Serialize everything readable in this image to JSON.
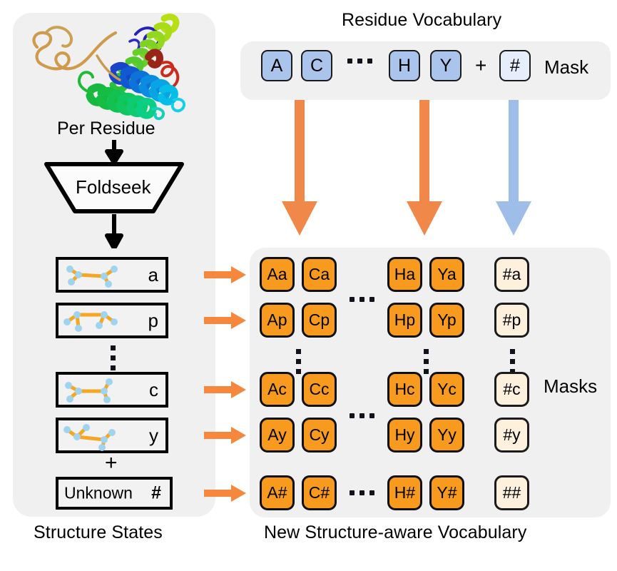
{
  "figure": {
    "title": "Structure-aware vocabulary construction diagram"
  },
  "left_panel": {
    "caption": "Structure States",
    "per_residue_label": "Per Residue",
    "foldseek_label": "Foldseek",
    "plus_sign": "+",
    "vertical_ellipsis": "⋮",
    "states": [
      {
        "letter": "a",
        "glyph": "structure-state-glyph-a"
      },
      {
        "letter": "p",
        "glyph": "structure-state-glyph-p"
      },
      {
        "letter": "c",
        "glyph": "structure-state-glyph-c"
      },
      {
        "letter": "y",
        "glyph": "structure-state-glyph-y"
      }
    ],
    "unknown": {
      "label": "Unknown",
      "symbol": "#"
    },
    "protein_icon": "protein-ribbon-structure"
  },
  "residue_vocabulary": {
    "title": "Residue Vocabulary",
    "tiles": [
      "A",
      "C",
      "H",
      "Y"
    ],
    "ellipsis": "···",
    "plus_sign": "+",
    "mask_token": "#",
    "mask_label": "Mask",
    "tile_color": "#aac4ec",
    "mask_tile_color": "#e7eefb"
  },
  "arrows": {
    "vertical": [
      {
        "name": "arrow-A-column",
        "color": "#f0884a"
      },
      {
        "name": "arrow-H-column",
        "color": "#f0884a"
      },
      {
        "name": "arrow-mask-column",
        "color": "#9ebde8"
      }
    ],
    "horizontal_color": "#f5883d",
    "black_arrow_color": "#000000"
  },
  "new_vocabulary": {
    "caption": "New Structure-aware Vocabulary",
    "masks_label": "Masks",
    "token_color": "#f79a1e",
    "mask_token_color": "#fdf0dc",
    "row_ellipsis": "···",
    "column_ellipsis": "⋮",
    "rows": [
      {
        "structure_state": "a",
        "tokens": [
          "Aa",
          "Ca",
          "Ha",
          "Ya",
          "#a"
        ]
      },
      {
        "structure_state": "p",
        "tokens": [
          "Ap",
          "Cp",
          "Hp",
          "Yp",
          "#p"
        ]
      },
      {
        "structure_state": "c",
        "tokens": [
          "Ac",
          "Cc",
          "Hc",
          "Yc",
          "#c"
        ]
      },
      {
        "structure_state": "y",
        "tokens": [
          "Ay",
          "Cy",
          "Hy",
          "Yy",
          "#y"
        ]
      },
      {
        "structure_state": "#",
        "tokens": [
          "A#",
          "C#",
          "H#",
          "Y#",
          "##"
        ]
      }
    ]
  }
}
